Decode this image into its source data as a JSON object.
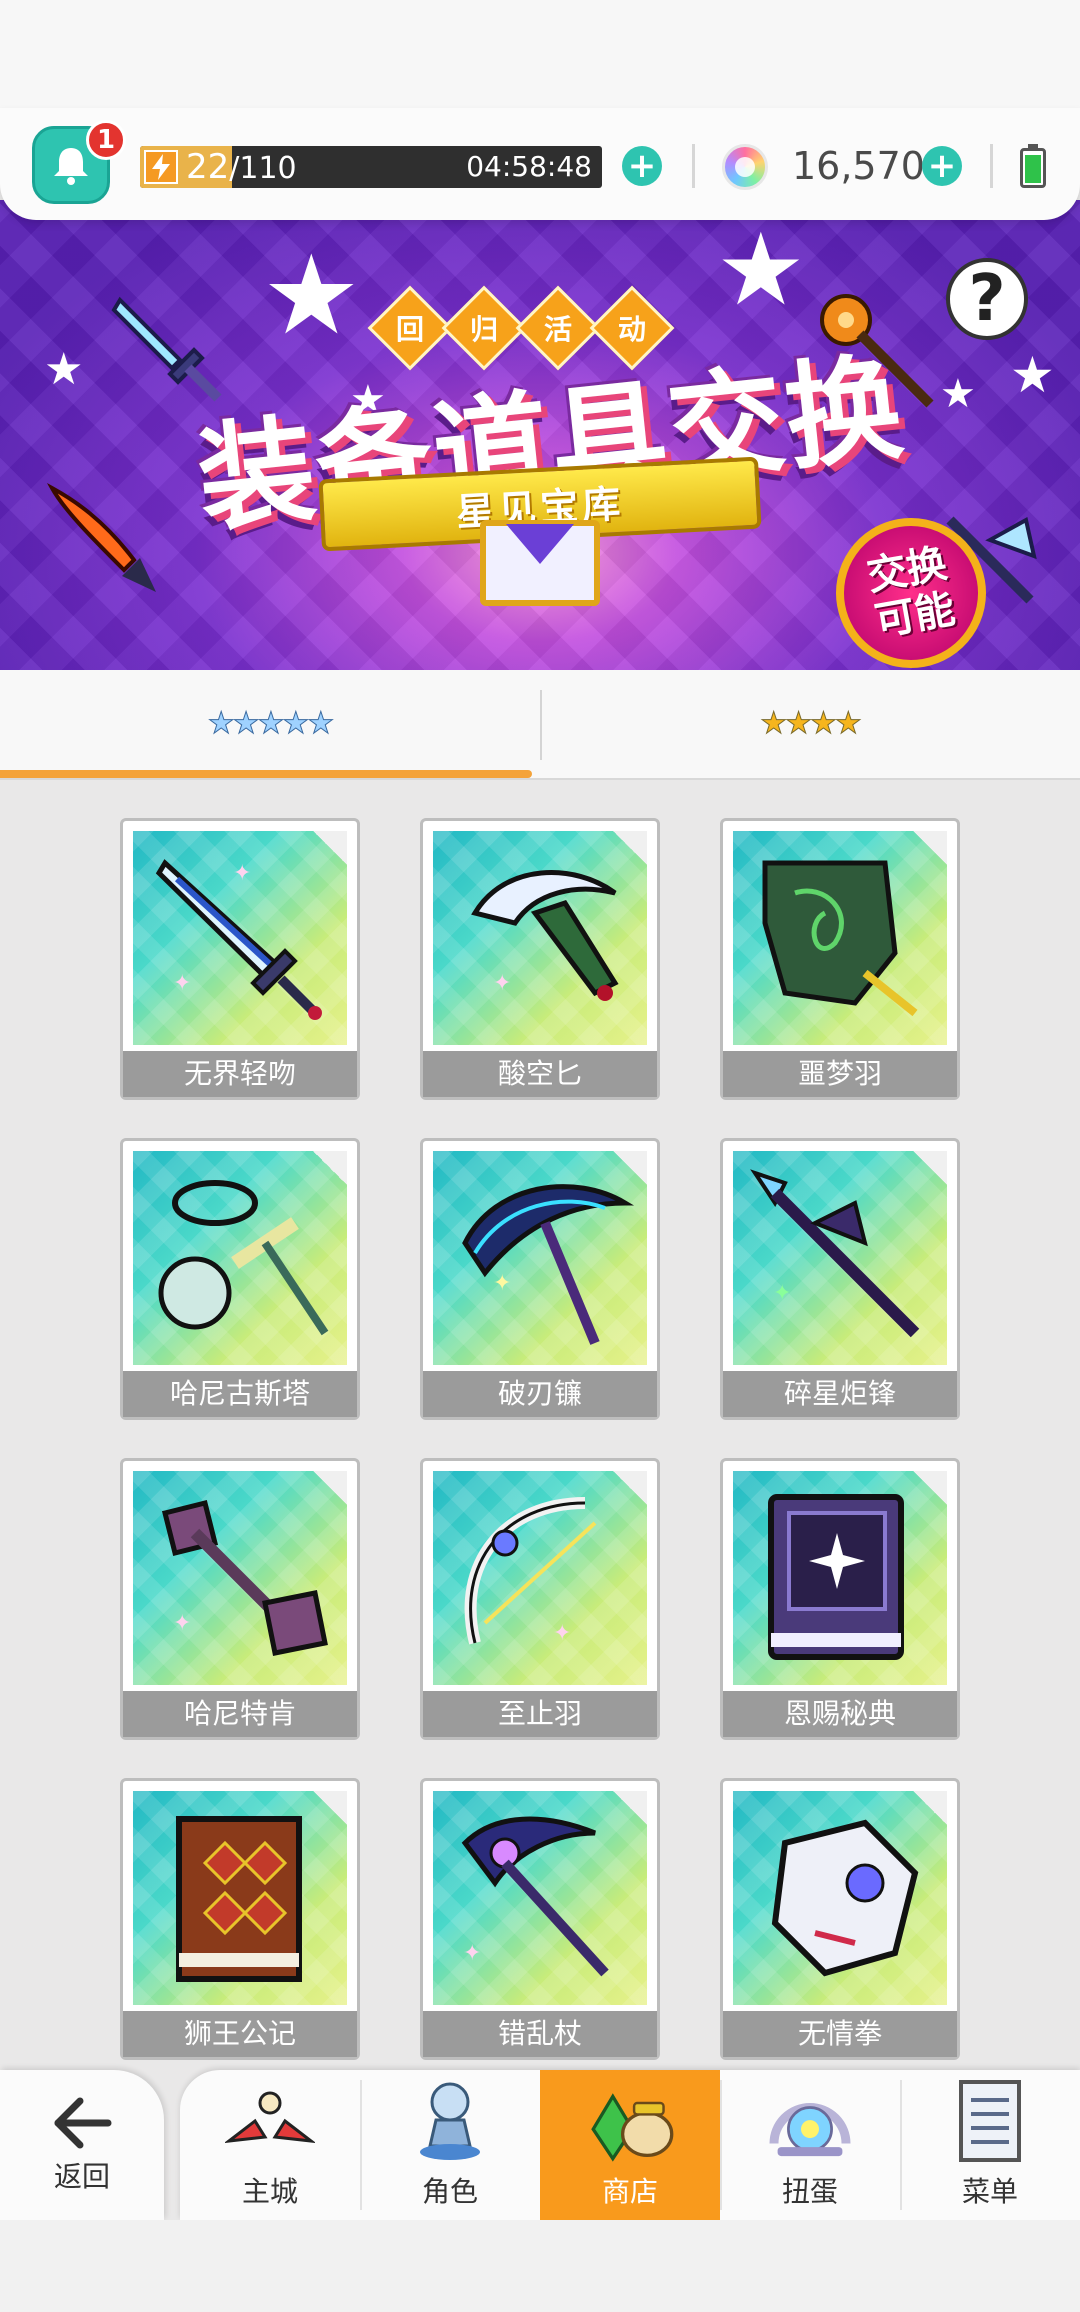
{
  "notifications": {
    "count": "1"
  },
  "energy": {
    "current": "22",
    "max": "/110",
    "timer": "04:58:48",
    "level": 0.2
  },
  "currency": {
    "gems": "16,570"
  },
  "banner": {
    "event_tags": [
      "回",
      "归",
      "活",
      "动"
    ],
    "title": "装备道具交换",
    "subtitle": "星见宝库",
    "badge_line1": "交换",
    "badge_line2": "可能",
    "help": "?"
  },
  "tabs": [
    {
      "stars": "★★★★★",
      "active": true
    },
    {
      "stars": "★★★★",
      "active": false
    }
  ],
  "items": [
    {
      "name": "无界轻吻",
      "icon": "sword-icon"
    },
    {
      "name": "酸空匕",
      "icon": "dagger-icon"
    },
    {
      "name": "噩梦羽",
      "icon": "feather-icon"
    },
    {
      "name": "哈尼古斯塔",
      "icon": "flail-icon"
    },
    {
      "name": "破刃镰",
      "icon": "scythe-icon"
    },
    {
      "name": "碎星炬锋",
      "icon": "spear-icon"
    },
    {
      "name": "哈尼特肯",
      "icon": "mace-icon"
    },
    {
      "name": "至止羽",
      "icon": "bow-icon"
    },
    {
      "name": "恩赐秘典",
      "icon": "tome-icon"
    },
    {
      "name": "狮王公记",
      "icon": "book-icon"
    },
    {
      "name": "错乱杖",
      "icon": "staff-icon"
    },
    {
      "name": "无情拳",
      "icon": "gauntlet-icon"
    }
  ],
  "nav": {
    "back": "返回",
    "items": [
      {
        "label": "主城",
        "icon": "castle-icon"
      },
      {
        "label": "角色",
        "icon": "character-icon"
      },
      {
        "label": "商店",
        "icon": "shop-icon",
        "active": true
      },
      {
        "label": "扭蛋",
        "icon": "gacha-icon"
      },
      {
        "label": "菜单",
        "icon": "menu-icon"
      }
    ]
  },
  "colors": {
    "accent": "#2ec4b0",
    "tab_indicator": "#f4a33a",
    "nav_active": "#f99a1c",
    "badge": "#e3342f"
  }
}
